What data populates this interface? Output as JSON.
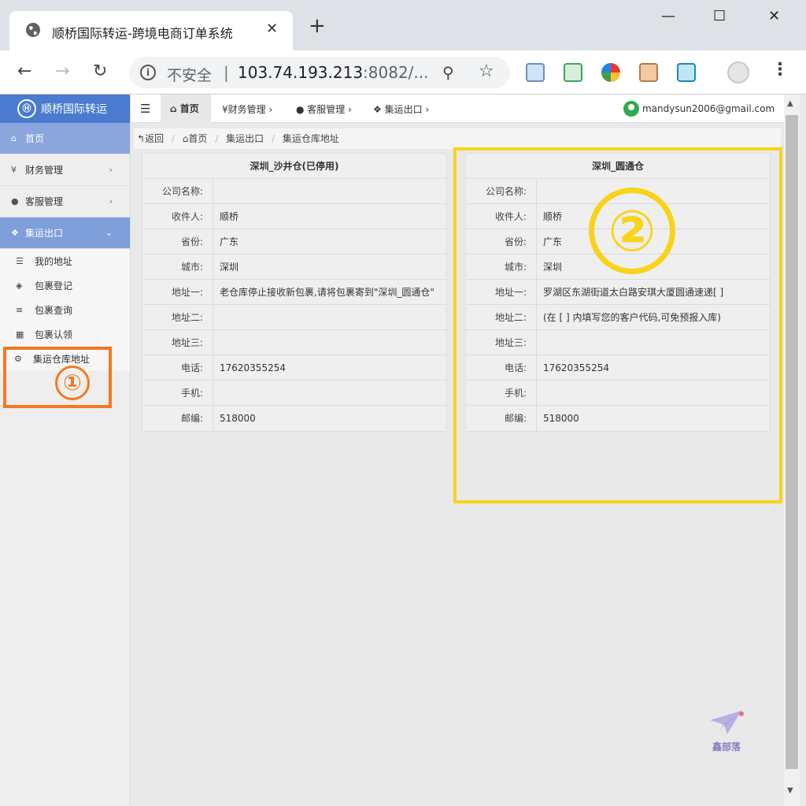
{
  "browser": {
    "tab_title": "顺桥国际转运-跨境电商订单系统",
    "tab_close": "✕",
    "new_tab": "+",
    "security_label": "不安全",
    "url_host": "103.74.193.213",
    "url_rest": ":8082/..."
  },
  "app": {
    "brand": "顺桥国际转运",
    "user_email": "mandysun2006@gmail.com"
  },
  "sidebar": {
    "items": [
      {
        "label": "首页",
        "icon": "home-icon"
      },
      {
        "label": "财务管理",
        "icon": "yen-icon"
      },
      {
        "label": "客服管理",
        "icon": "user-icon"
      },
      {
        "label": "集运出口",
        "icon": "cubes-icon"
      }
    ],
    "subitems": [
      {
        "label": "我的地址",
        "icon": "list-icon"
      },
      {
        "label": "包裹登记",
        "icon": "box-icon"
      },
      {
        "label": "包裹查询",
        "icon": "align-icon"
      },
      {
        "label": "包裹认领",
        "icon": "grid-icon"
      },
      {
        "label": "集运仓库地址",
        "icon": "gear-icon"
      }
    ]
  },
  "topnav": {
    "home": "首页",
    "finance": "¥财务管理",
    "service": "客服管理",
    "export": "集运出口"
  },
  "breadcrumb": {
    "back": "返回",
    "home": "首页",
    "section": "集运出口",
    "current": "集运仓库地址"
  },
  "warehouses": [
    {
      "title": "深圳_沙井仓(已停用)",
      "rows": [
        {
          "label": "公司名称:",
          "value": ""
        },
        {
          "label": "收件人:",
          "value": "顺桥"
        },
        {
          "label": "省份:",
          "value": "广东"
        },
        {
          "label": "城市:",
          "value": "深圳"
        },
        {
          "label": "地址一:",
          "value": "老仓库停止接收新包裹,请将包裹寄到\"深圳_圆通仓\""
        },
        {
          "label": "地址二:",
          "value": ""
        },
        {
          "label": "地址三:",
          "value": ""
        },
        {
          "label": "电话:",
          "value": "17620355254"
        },
        {
          "label": "手机:",
          "value": ""
        },
        {
          "label": "邮编:",
          "value": "518000"
        }
      ]
    },
    {
      "title": "深圳_圆通仓",
      "rows": [
        {
          "label": "公司名称:",
          "value": ""
        },
        {
          "label": "收件人:",
          "value": "顺桥"
        },
        {
          "label": "省份:",
          "value": "广东"
        },
        {
          "label": "城市:",
          "value": "深圳"
        },
        {
          "label": "地址一:",
          "value": "罗湖区东湖街道太白路安琪大厦圆通速递[ ]"
        },
        {
          "label": "地址二:",
          "value": "(在 [ ] 内填写您的客户代码,可免预报入库)"
        },
        {
          "label": "地址三:",
          "value": ""
        },
        {
          "label": "电话:",
          "value": "17620355254"
        },
        {
          "label": "手机:",
          "value": ""
        },
        {
          "label": "邮编:",
          "value": "518000"
        }
      ]
    }
  ],
  "annotations": {
    "one": "①",
    "two": "②",
    "color_one": "#f47920",
    "color_two": "#f9d31a"
  },
  "watermark": "鑫部落"
}
